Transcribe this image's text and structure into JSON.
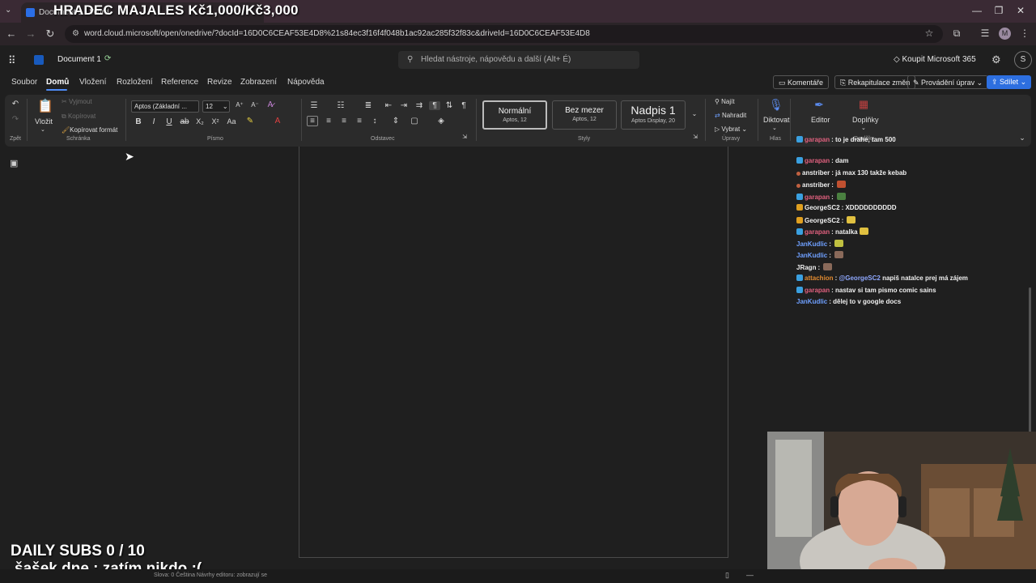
{
  "browser": {
    "tab_title": "Document 1 - Word",
    "overlay_title": "HRADEC MAJALES Kč1,000/Kč3,000",
    "url": "word.cloud.microsoft/open/onedrive/?docId=16D0C6CEAF53E4D8%21s84ec3f16f4f048b1ac92ac285f32f83c&driveId=16D0C6CEAF53E4D8",
    "profile_initial": "M"
  },
  "office": {
    "doc_name": "Document 1",
    "search_placeholder": "Hledat nástroje, nápovědu a další (Alt+ É)",
    "buy_label": "Koupit Microsoft 365",
    "avatar_initial": "S"
  },
  "menu": {
    "tabs": [
      "Soubor",
      "Domů",
      "Vložení",
      "Rozložení",
      "Reference",
      "Revize",
      "Zobrazení",
      "Nápověda"
    ],
    "comments": "Komentáře",
    "catch_up": "Rekapitulace změn",
    "editing": "Provádění úprav",
    "share": "Sdílet"
  },
  "ribbon": {
    "undo_group": "Zpět",
    "paste": "Vložit",
    "cut": "Vyjmout",
    "copy": "Kopírovat",
    "format_painter": "Kopírovat formát",
    "clipboard_group": "Schránka",
    "font_name": "Aptos (Základní ...",
    "font_size": "12",
    "font_group": "Písmo",
    "paragraph_group": "Odstavec",
    "styles": [
      {
        "name": "Normální",
        "sub": "Aptos, 12"
      },
      {
        "name": "Bez mezer",
        "sub": "Aptos, 12"
      },
      {
        "name": "Nadpis 1",
        "sub": "Aptos Display, 20"
      }
    ],
    "styles_group": "Styly",
    "find": "Najít",
    "replace": "Nahradit",
    "select": "Vybrat",
    "editing_group": "Úpravy",
    "dictate": "Diktovat",
    "voice_group": "Hlas",
    "editor": "Editor",
    "addins": "Doplňky",
    "addins_group": "Doplňky"
  },
  "chat": {
    "messages": [
      {
        "user": "garapan",
        "color": "#e0607e",
        "badge": "#3aa0e0",
        "text": "to je drahe, tam 500"
      },
      {
        "user": "garapan",
        "color": "#e0607e",
        "badge": "#3aa0e0",
        "text": "dam"
      },
      {
        "user": "anstriber",
        "color": "#e8e8e8",
        "badge": "#c06040",
        "text": "já max 130 takže kebab"
      },
      {
        "user": "anstriber",
        "color": "#e8e8e8",
        "badge": "#c06040",
        "text": ""
      },
      {
        "user": "garapan",
        "color": "#e0607e",
        "badge": "#3aa0e0",
        "text": ""
      },
      {
        "user": "GeorgeSC2",
        "color": "#e8e8e8",
        "badge": "#e0a020",
        "text": "XDDDDDDDDDD"
      },
      {
        "user": "GeorgeSC2",
        "color": "#e8e8e8",
        "badge": "#e0a020",
        "text": ""
      },
      {
        "user": "garapan",
        "color": "#e0607e",
        "badge": "#3aa0e0",
        "text": "natalka"
      },
      {
        "user": "JanKudlic",
        "color": "#6fa0ff",
        "badge": "",
        "text": ""
      },
      {
        "user": "JanKudlic",
        "color": "#6fa0ff",
        "badge": "",
        "text": ""
      },
      {
        "user": "JRagn",
        "color": "#e8e8e8",
        "badge": "",
        "text": ""
      },
      {
        "user": "attachion",
        "color": "#e08a30",
        "badge": "#3aa0e0",
        "mention": "@GeorgeSC2",
        "text": "napiš natalce prej má zájem"
      },
      {
        "user": "garapan",
        "color": "#e0607e",
        "badge": "#3aa0e0",
        "text": "nastav si tam pismo comic sains"
      },
      {
        "user": "JanKudlic",
        "color": "#6fa0ff",
        "badge": "",
        "text": "dělej to v google docs"
      }
    ]
  },
  "overlay": {
    "daily_subs": "DAILY SUBS 0 / 10",
    "sasek": "šašek dne : zatím nikdo :("
  },
  "status": {
    "text": "Slova: 0   Čeština   Návrhy editoru: zobrazují se"
  }
}
